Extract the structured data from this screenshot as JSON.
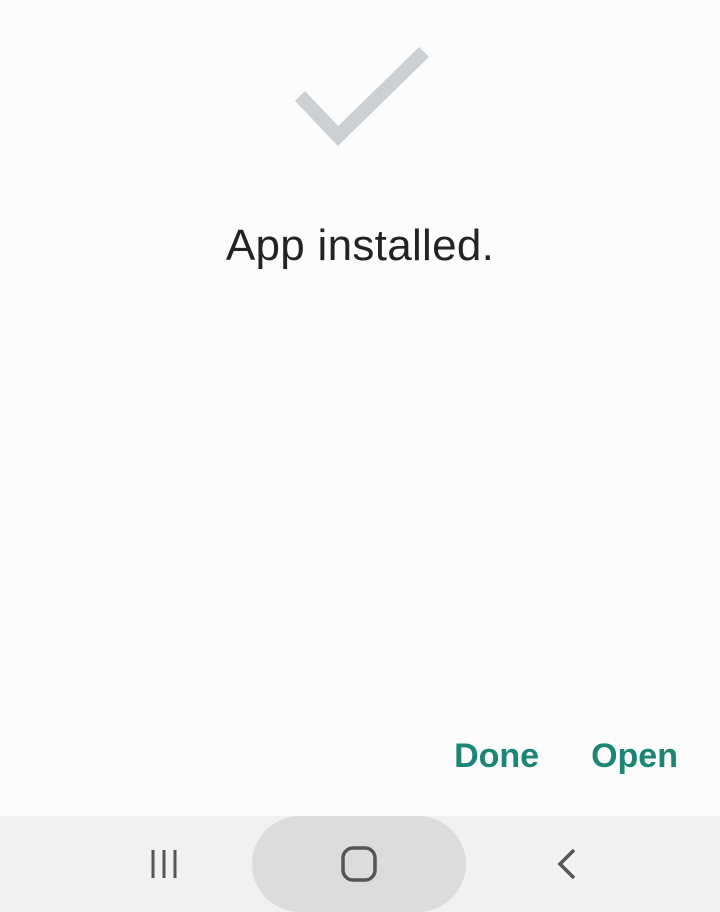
{
  "dialog": {
    "message": "App installed.",
    "icon": "checkmark-icon",
    "icon_color": "#cdd0d3"
  },
  "actions": {
    "done_label": "Done",
    "open_label": "Open",
    "accent_color": "#1c8576"
  },
  "navbar": {
    "recents_icon": "recents-icon",
    "home_icon": "home-icon",
    "back_icon": "back-icon"
  }
}
